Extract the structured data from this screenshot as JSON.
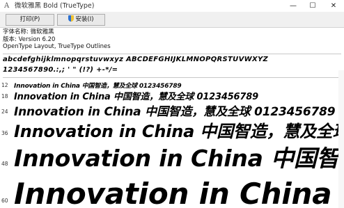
{
  "window": {
    "title": "微软雅黑 Bold (TrueType)",
    "controls": {
      "minimize": "—",
      "maximize": "☐",
      "close": "✕"
    }
  },
  "toolbar": {
    "print_label": "打印(P)",
    "install_label": "安装(I)"
  },
  "info": {
    "font_name": "字体名称: 微软雅黑",
    "version": "版本: Version 6.20",
    "format": "OpenType Layout, TrueType Outlines"
  },
  "charset": {
    "line1": "abcdefghijklmnopqrstuvwxyz ABCDEFGHIJKLMNOPQRSTUVWXYZ",
    "line2": "1234567890.:,; ' \" (!?) +-*/="
  },
  "samples": [
    {
      "size": "12",
      "text": "Innovation in China 中国智造，慧及全球 0123456789"
    },
    {
      "size": "18",
      "text": "Innovation in China 中国智造，慧及全球 0123456789"
    },
    {
      "size": "24",
      "text": "Innovation in China 中国智造，慧及全球 0123456789"
    },
    {
      "size": "36",
      "text": "Innovation in China 中国智造，慧及全球"
    },
    {
      "size": "48",
      "text": "Innovation in China 中国智造"
    },
    {
      "size": "60",
      "text": "Innovation in China 中"
    }
  ]
}
